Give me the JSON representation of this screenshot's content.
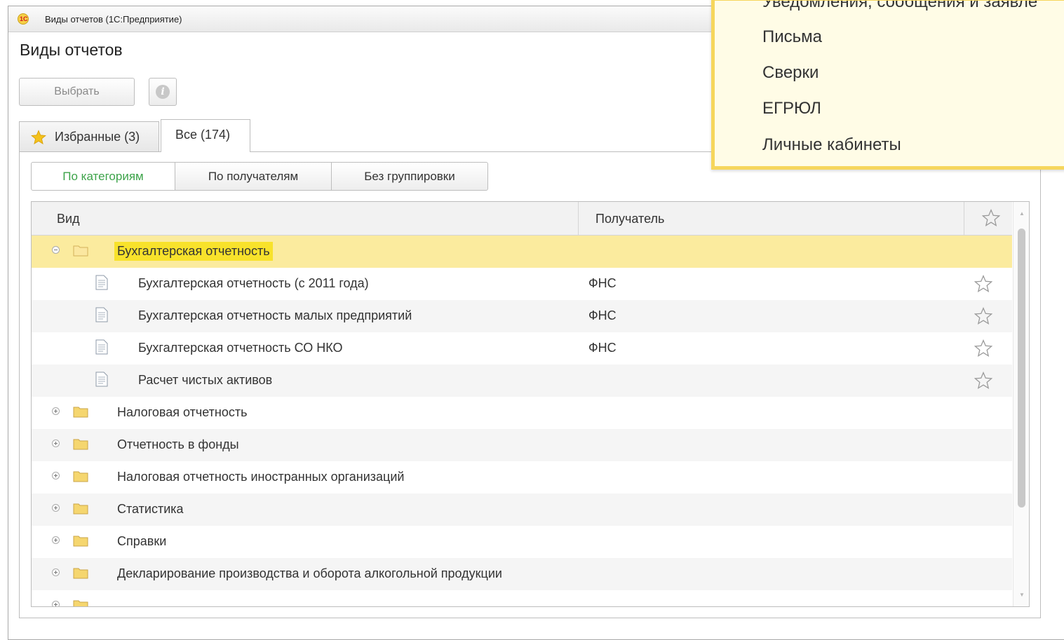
{
  "window": {
    "title": "Виды отчетов  (1С:Предприятие)",
    "logo_text": "1С"
  },
  "form": {
    "title": "Виды отчетов"
  },
  "toolbar": {
    "select_label": "Выбрать",
    "info_icon": "info-icon"
  },
  "tabs": [
    {
      "label": "Избранные (3)",
      "icon": "star-icon",
      "active": false
    },
    {
      "label": "Все (174)",
      "active": true
    }
  ],
  "grouping": {
    "buttons": [
      {
        "label": "По категориям",
        "active": true
      },
      {
        "label": "По получателям",
        "active": false
      },
      {
        "label": "Без группировки",
        "active": false
      }
    ],
    "active_color": "#3da34a"
  },
  "table": {
    "columns": [
      "Вид",
      "Получатель"
    ],
    "favorite_column_icon": "star-outline-icon",
    "rows": [
      {
        "name": "Бухгалтерская отчетность",
        "type": "group",
        "expanded": true,
        "recipient": "",
        "star": false,
        "selected": true
      },
      {
        "name": "Бухгалтерская отчетность (с 2011 года)",
        "type": "item",
        "recipient": "ФНС",
        "star": true
      },
      {
        "name": "Бухгалтерская отчетность малых предприятий",
        "type": "item",
        "recipient": "ФНС",
        "star": true
      },
      {
        "name": "Бухгалтерская отчетность СО НКО",
        "type": "item",
        "recipient": "ФНС",
        "star": true
      },
      {
        "name": "Расчет чистых активов",
        "type": "item",
        "recipient": "",
        "star": true
      },
      {
        "name": "Налоговая отчетность",
        "type": "group",
        "expanded": false,
        "recipient": "",
        "star": false
      },
      {
        "name": "Отчетность в фонды",
        "type": "group",
        "expanded": false,
        "recipient": "",
        "star": false
      },
      {
        "name": "Налоговая отчетность иностранных организаций",
        "type": "group",
        "expanded": false,
        "recipient": "",
        "star": false
      },
      {
        "name": "Статистика",
        "type": "group",
        "expanded": false,
        "recipient": "",
        "star": false
      },
      {
        "name": "Справки",
        "type": "group",
        "expanded": false,
        "recipient": "",
        "star": false
      },
      {
        "name": "Декларирование производства и оборота алкогольной продукции",
        "type": "group",
        "expanded": false,
        "recipient": "",
        "star": false
      },
      {
        "name": "",
        "type": "group",
        "expanded": false,
        "recipient": "",
        "star": false
      }
    ],
    "selection_color": "#fbeb9e",
    "highlight_color": "#f8e22b"
  },
  "popup": {
    "items": [
      "Уведомления, сообщения и заявле",
      "Письма",
      "Сверки",
      "ЕГРЮЛ",
      "Личные кабинеты"
    ],
    "background": "#fffce6",
    "border": "#f6d65c"
  }
}
